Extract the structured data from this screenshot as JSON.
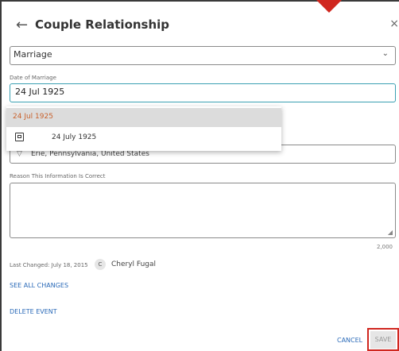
{
  "dialog": {
    "title": "Couple Relationship",
    "back_icon": "arrow-left-icon",
    "close_icon": "close-icon"
  },
  "relationship_type": {
    "value": "Marriage",
    "icon": "chevron-down-icon"
  },
  "date_field": {
    "label": "Date of Marriage",
    "value": "24 Jul 1925"
  },
  "date_suggestions": [
    {
      "text": "24 Jul 1925"
    },
    {
      "text": "24 July 1925",
      "icon": "calendar-icon"
    }
  ],
  "place_field": {
    "value": "Erie, Pennsylvania, United States",
    "icon": "location-icon"
  },
  "reason_field": {
    "label": "Reason This Information Is Correct",
    "value": "",
    "char_limit": "2,000"
  },
  "last_changed": {
    "text": "Last Changed: July 18, 2015",
    "badge": "C",
    "user": "Cheryl Fugal"
  },
  "links": {
    "see_all_changes": "SEE ALL CHANGES",
    "delete_event": "DELETE EVENT"
  },
  "actions": {
    "cancel": "CANCEL",
    "save": "SAVE"
  },
  "colors": {
    "accent": "#3aa0b2",
    "link": "#2a6ab8",
    "suggestion_highlight": "#c9622d",
    "annotation_red": "#d0271f"
  }
}
